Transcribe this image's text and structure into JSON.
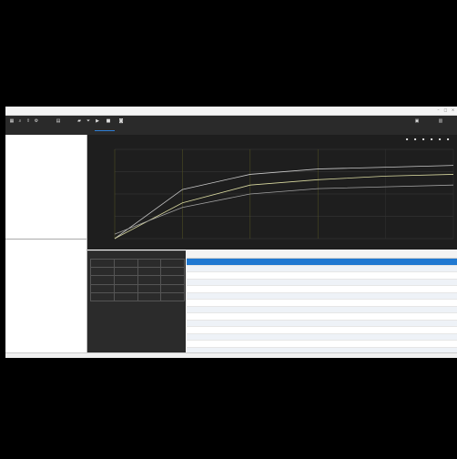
{
  "window": {
    "title": ""
  },
  "toolbar": {
    "tools": [
      "grid-icon",
      "search-icon",
      "export-icon",
      "settings-icon",
      "document-icon",
      "chart-icon",
      "filter-icon",
      "play-icon",
      "stop-icon",
      "camera-icon"
    ],
    "labels": [
      "",
      "",
      "",
      ""
    ],
    "right_tools": [
      "save-icon",
      "print-icon"
    ],
    "right_labels": [
      "",
      ""
    ]
  },
  "left_panel": {
    "top_headers": [
      "",
      "",
      "",
      ""
    ],
    "top_rows": [
      [
        "",
        "",
        "",
        ""
      ]
    ],
    "bottom_headers": [
      "",
      "",
      ""
    ],
    "bottom_rows": [
      [
        "",
        "",
        ""
      ]
    ]
  },
  "chart_data": {
    "type": "line",
    "title": "",
    "xlabel": "",
    "ylabel": "",
    "y_tick_labels": [
      "",
      "",
      "",
      "",
      ""
    ],
    "x_tick_labels": [
      "",
      "",
      "",
      "",
      "",
      ""
    ],
    "grid": true,
    "series": [
      {
        "color": "#c8c8c8",
        "x": [
          0,
          2,
          4,
          6,
          8,
          10
        ],
        "y": [
          0,
          0.55,
          0.72,
          0.78,
          0.8,
          0.82
        ]
      },
      {
        "color": "#d9d9a0",
        "x": [
          0,
          2,
          4,
          6,
          8,
          10
        ],
        "y": [
          0,
          0.4,
          0.6,
          0.66,
          0.7,
          0.72
        ]
      },
      {
        "color": "#a0a0a0",
        "x": [
          0,
          2,
          4,
          6,
          8,
          10
        ],
        "y": [
          0.05,
          0.35,
          0.5,
          0.56,
          0.58,
          0.6
        ]
      }
    ],
    "xlim": [
      0,
      10
    ],
    "ylim": [
      0,
      1
    ]
  },
  "stats": {
    "title": "",
    "rows": [
      [
        "",
        "",
        "",
        ""
      ],
      [
        "",
        "",
        "",
        ""
      ],
      [
        "",
        "",
        "",
        ""
      ],
      [
        "",
        "",
        "",
        ""
      ],
      [
        "",
        "",
        "",
        ""
      ]
    ]
  },
  "grid_table": {
    "headers": [
      "",
      "",
      "",
      "",
      "",
      "",
      "",
      ""
    ],
    "rows": [
      [
        "",
        "",
        "",
        "",
        "",
        "",
        "",
        ""
      ],
      [
        "",
        "",
        "",
        "",
        "",
        "",
        "",
        ""
      ],
      [
        "",
        "",
        "",
        "",
        "",
        "",
        "",
        ""
      ],
      [
        "",
        "",
        "",
        "",
        "",
        "",
        "",
        ""
      ],
      [
        "",
        "",
        "",
        "",
        "",
        "",
        "",
        ""
      ],
      [
        "",
        "",
        "",
        "",
        "",
        "",
        "",
        ""
      ],
      [
        "",
        "",
        "",
        "",
        "",
        "",
        "",
        ""
      ],
      [
        "",
        "",
        "",
        "",
        "",
        "",
        "",
        ""
      ],
      [
        "",
        "",
        "",
        "",
        "",
        "",
        "",
        ""
      ],
      [
        "",
        "",
        "",
        "",
        "",
        "",
        "",
        ""
      ],
      [
        "",
        "",
        "",
        "",
        "",
        "",
        "",
        ""
      ],
      [
        "",
        "",
        "",
        "",
        "",
        "",
        "",
        ""
      ],
      [
        "",
        "",
        "",
        "",
        "",
        "",
        "",
        ""
      ],
      [
        "",
        "",
        "",
        "",
        "",
        "",
        "",
        ""
      ]
    ],
    "selected_row": 0
  },
  "statusbar": {
    "text": ""
  }
}
